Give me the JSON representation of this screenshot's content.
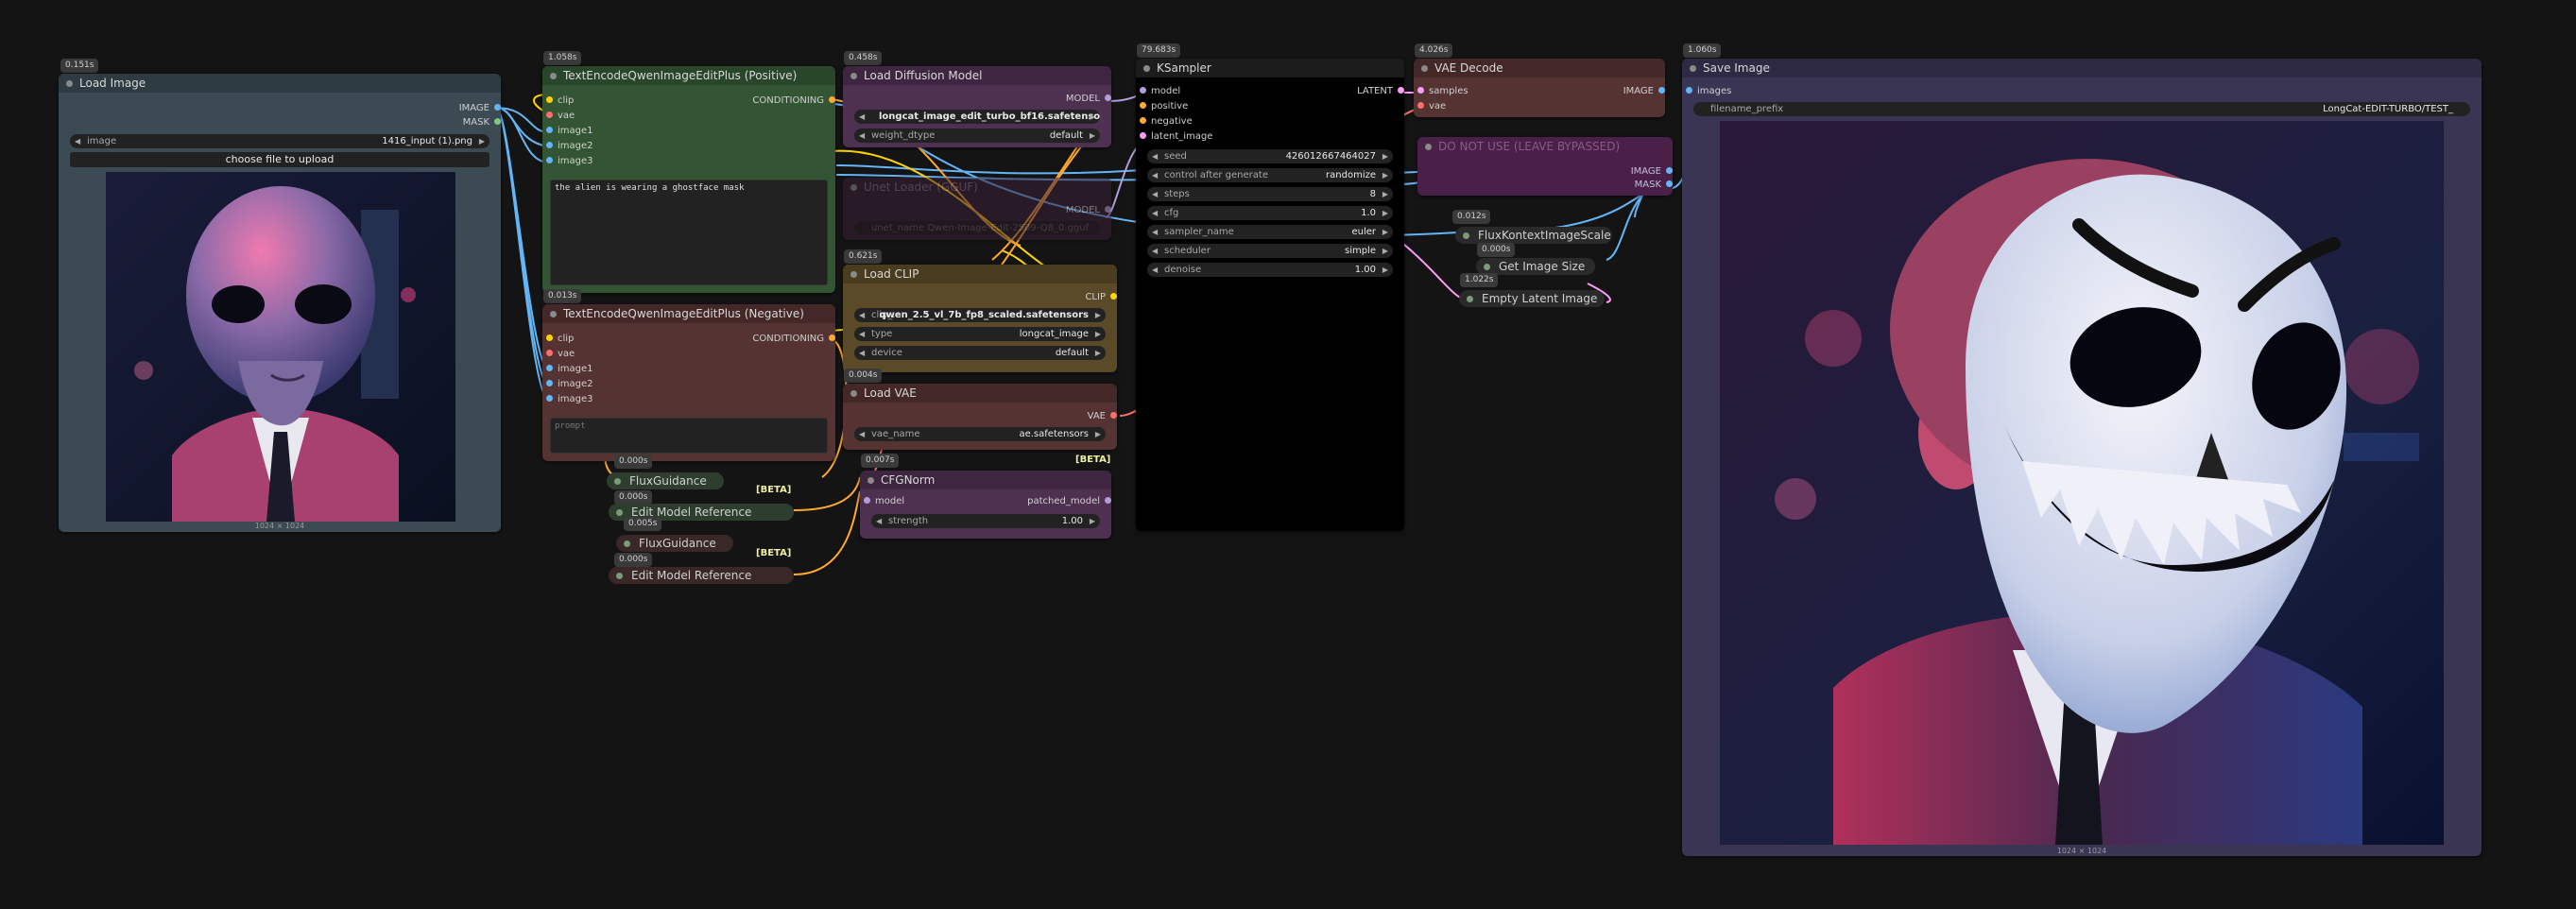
{
  "colors": {
    "bg": "#141414",
    "image_slot": "#64b5f6",
    "clip_slot": "#ffd500",
    "conditioning_slot": "#ffa931",
    "model_slot": "#b39ddb",
    "vae_slot": "#ff6e6e",
    "latent_slot": "#ff9cf9",
    "mask_slot": "#81c784"
  },
  "load_image": {
    "timing": "0.151s",
    "title": "Load Image",
    "outputs": [
      "IMAGE",
      "MASK"
    ],
    "image_label": "image",
    "image_value": "1416_input (1).png",
    "upload_label": "choose file to upload",
    "dims": "1024 × 1024"
  },
  "te_positive": {
    "timing": "1.058s",
    "title": "TextEncodeQwenImageEditPlus (Positive)",
    "inputs": [
      "clip",
      "vae",
      "image1",
      "image2",
      "image3"
    ],
    "output": "CONDITIONING",
    "prompt": "the alien is wearing a ghostface mask"
  },
  "te_negative": {
    "timing": "0.013s",
    "title": "TextEncodeQwenImageEditPlus (Negative)",
    "inputs": [
      "clip",
      "vae",
      "image1",
      "image2",
      "image3"
    ],
    "output": "CONDITIONING",
    "prompt_placeholder": "prompt"
  },
  "load_diffusion": {
    "timing": "0.458s",
    "title": "Load Diffusion Model",
    "output": "MODEL",
    "unet_name": "longcat_image_edit_turbo_bf16.safetensors",
    "weight_dtype_label": "weight_dtype",
    "weight_dtype": "default"
  },
  "unet_gguf": {
    "title": "Unet Loader (GGUF)",
    "output": "MODEL",
    "unet_name": "unet_name    Qwen-Image-Edit-2509-Q8_0.gguf"
  },
  "load_clip": {
    "timing": "0.621s",
    "title": "Load CLIP",
    "output": "CLIP",
    "clip_label": "clip_...",
    "clip_name": "qwen_2.5_vl_7b_fp8_scaled.safetensors",
    "type_label": "type",
    "type": "longcat_image",
    "device_label": "device",
    "device": "default"
  },
  "load_vae": {
    "timing": "0.004s",
    "title": "Load VAE",
    "output": "VAE",
    "vae_label": "vae_name",
    "vae_name": "ae.safetensors"
  },
  "flux1": {
    "timing": "0.000s",
    "title": "FluxGuidance",
    "beta": "[BETA]"
  },
  "edit_ref1": {
    "timing": "0.000s",
    "title": "Edit Model Reference"
  },
  "flux2": {
    "timing": "0.005s",
    "title": "FluxGuidance",
    "beta": "[BETA]"
  },
  "edit_ref2": {
    "timing": "0.000s",
    "title": "Edit Model Reference"
  },
  "cfgnorm": {
    "timing": "0.007s",
    "title": "CFGNorm",
    "beta": "[BETA]",
    "input": "model",
    "output": "patched_model",
    "strength_label": "strength",
    "strength": "1.00"
  },
  "ksampler": {
    "timing": "79.683s",
    "title": "KSampler",
    "inputs": [
      "model",
      "positive",
      "negative",
      "latent_image"
    ],
    "output": "LATENT",
    "widgets": [
      {
        "label": "seed",
        "value": "426012667464027"
      },
      {
        "label": "control after generate",
        "value": "randomize"
      },
      {
        "label": "steps",
        "value": "8"
      },
      {
        "label": "cfg",
        "value": "1.0"
      },
      {
        "label": "sampler_name",
        "value": "euler"
      },
      {
        "label": "scheduler",
        "value": "simple"
      },
      {
        "label": "denoise",
        "value": "1.00"
      }
    ]
  },
  "vae_decode": {
    "timing": "4.026s",
    "title": "VAE Decode",
    "inputs": [
      "samples",
      "vae"
    ],
    "output": "IMAGE"
  },
  "bypassed": {
    "title": "DO NOT USE (LEAVE BYPASSED)",
    "out1": "IMAGE",
    "out2": "MASK"
  },
  "flux_scale": {
    "timing": "0.012s",
    "title": "FluxKontextImageScale"
  },
  "get_size": {
    "timing": "0.000s",
    "title": "Get Image Size"
  },
  "empty_latent": {
    "timing": "1.022s",
    "title": "Empty Latent Image"
  },
  "save_image": {
    "timing": "1.060s",
    "title": "Save Image",
    "input": "images",
    "prefix_label": "filename_prefix",
    "prefix": "LongCat-EDIT-TURBO/TEST_",
    "dims": "1024 × 1024"
  }
}
